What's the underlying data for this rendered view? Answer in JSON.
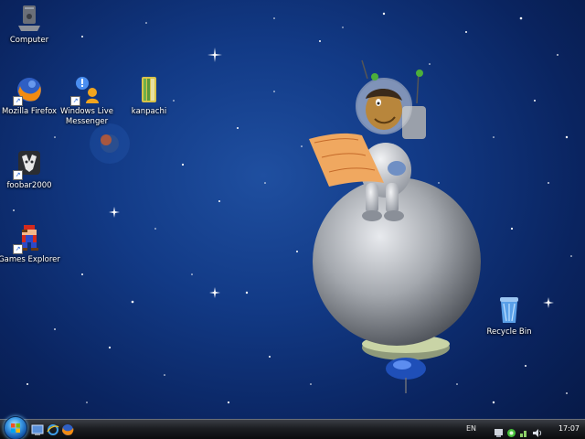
{
  "desktop": {
    "icons": [
      {
        "label": "Computer"
      },
      {
        "label": "Mozilla Firefox"
      },
      {
        "label": "Windows Live Messenger"
      },
      {
        "label": "kanpachi"
      },
      {
        "label": "foobar2000"
      },
      {
        "label": "Games Explorer"
      },
      {
        "label": "Recycle Bin"
      }
    ]
  },
  "taskbar": {
    "quick_launch": [
      "show-desktop-icon",
      "internet-explorer-icon",
      "firefox-icon"
    ],
    "language": "EN",
    "clock": "17:07"
  },
  "colors": {
    "background": "#123a86",
    "taskbar": "#1c1e22",
    "start_orb": "#3f9ee8"
  }
}
